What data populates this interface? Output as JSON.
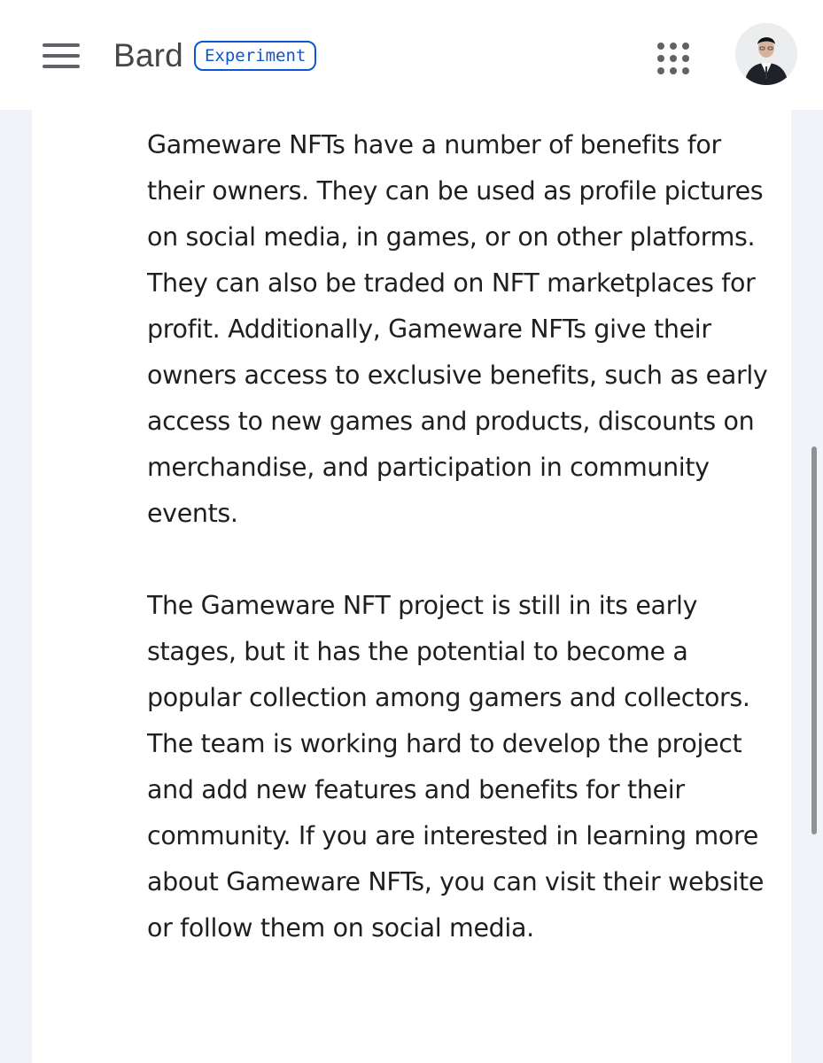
{
  "header": {
    "brand": "Bard",
    "badge": "Experiment",
    "menu_icon": "hamburger-menu-icon",
    "apps_icon": "google-apps-grid-icon",
    "avatar": "user-avatar"
  },
  "response": {
    "paragraphs": [
      "Gameware NFTs have a number of benefits for their owners. They can be used as profile pictures on social media, in games, or on other platforms. They can also be traded on NFT marketplaces for profit. Additionally, Gameware NFTs give their owners access to exclusive benefits, such as early access to new games and products, discounts on merchandise, and participation in community events.",
      "The Gameware NFT project is still in its early stages, but it has the potential to become a popular collection among gamers and collectors. The team is working hard to develop the project and add new features and benefits for their community. If you are interested in learning more about Gameware NFTs, you can visit their website or follow them on social media."
    ]
  },
  "colors": {
    "accent": "#0b57d0",
    "icon": "#5f6368",
    "text": "#1f1f1f",
    "page_background": "#f0f4f9"
  }
}
